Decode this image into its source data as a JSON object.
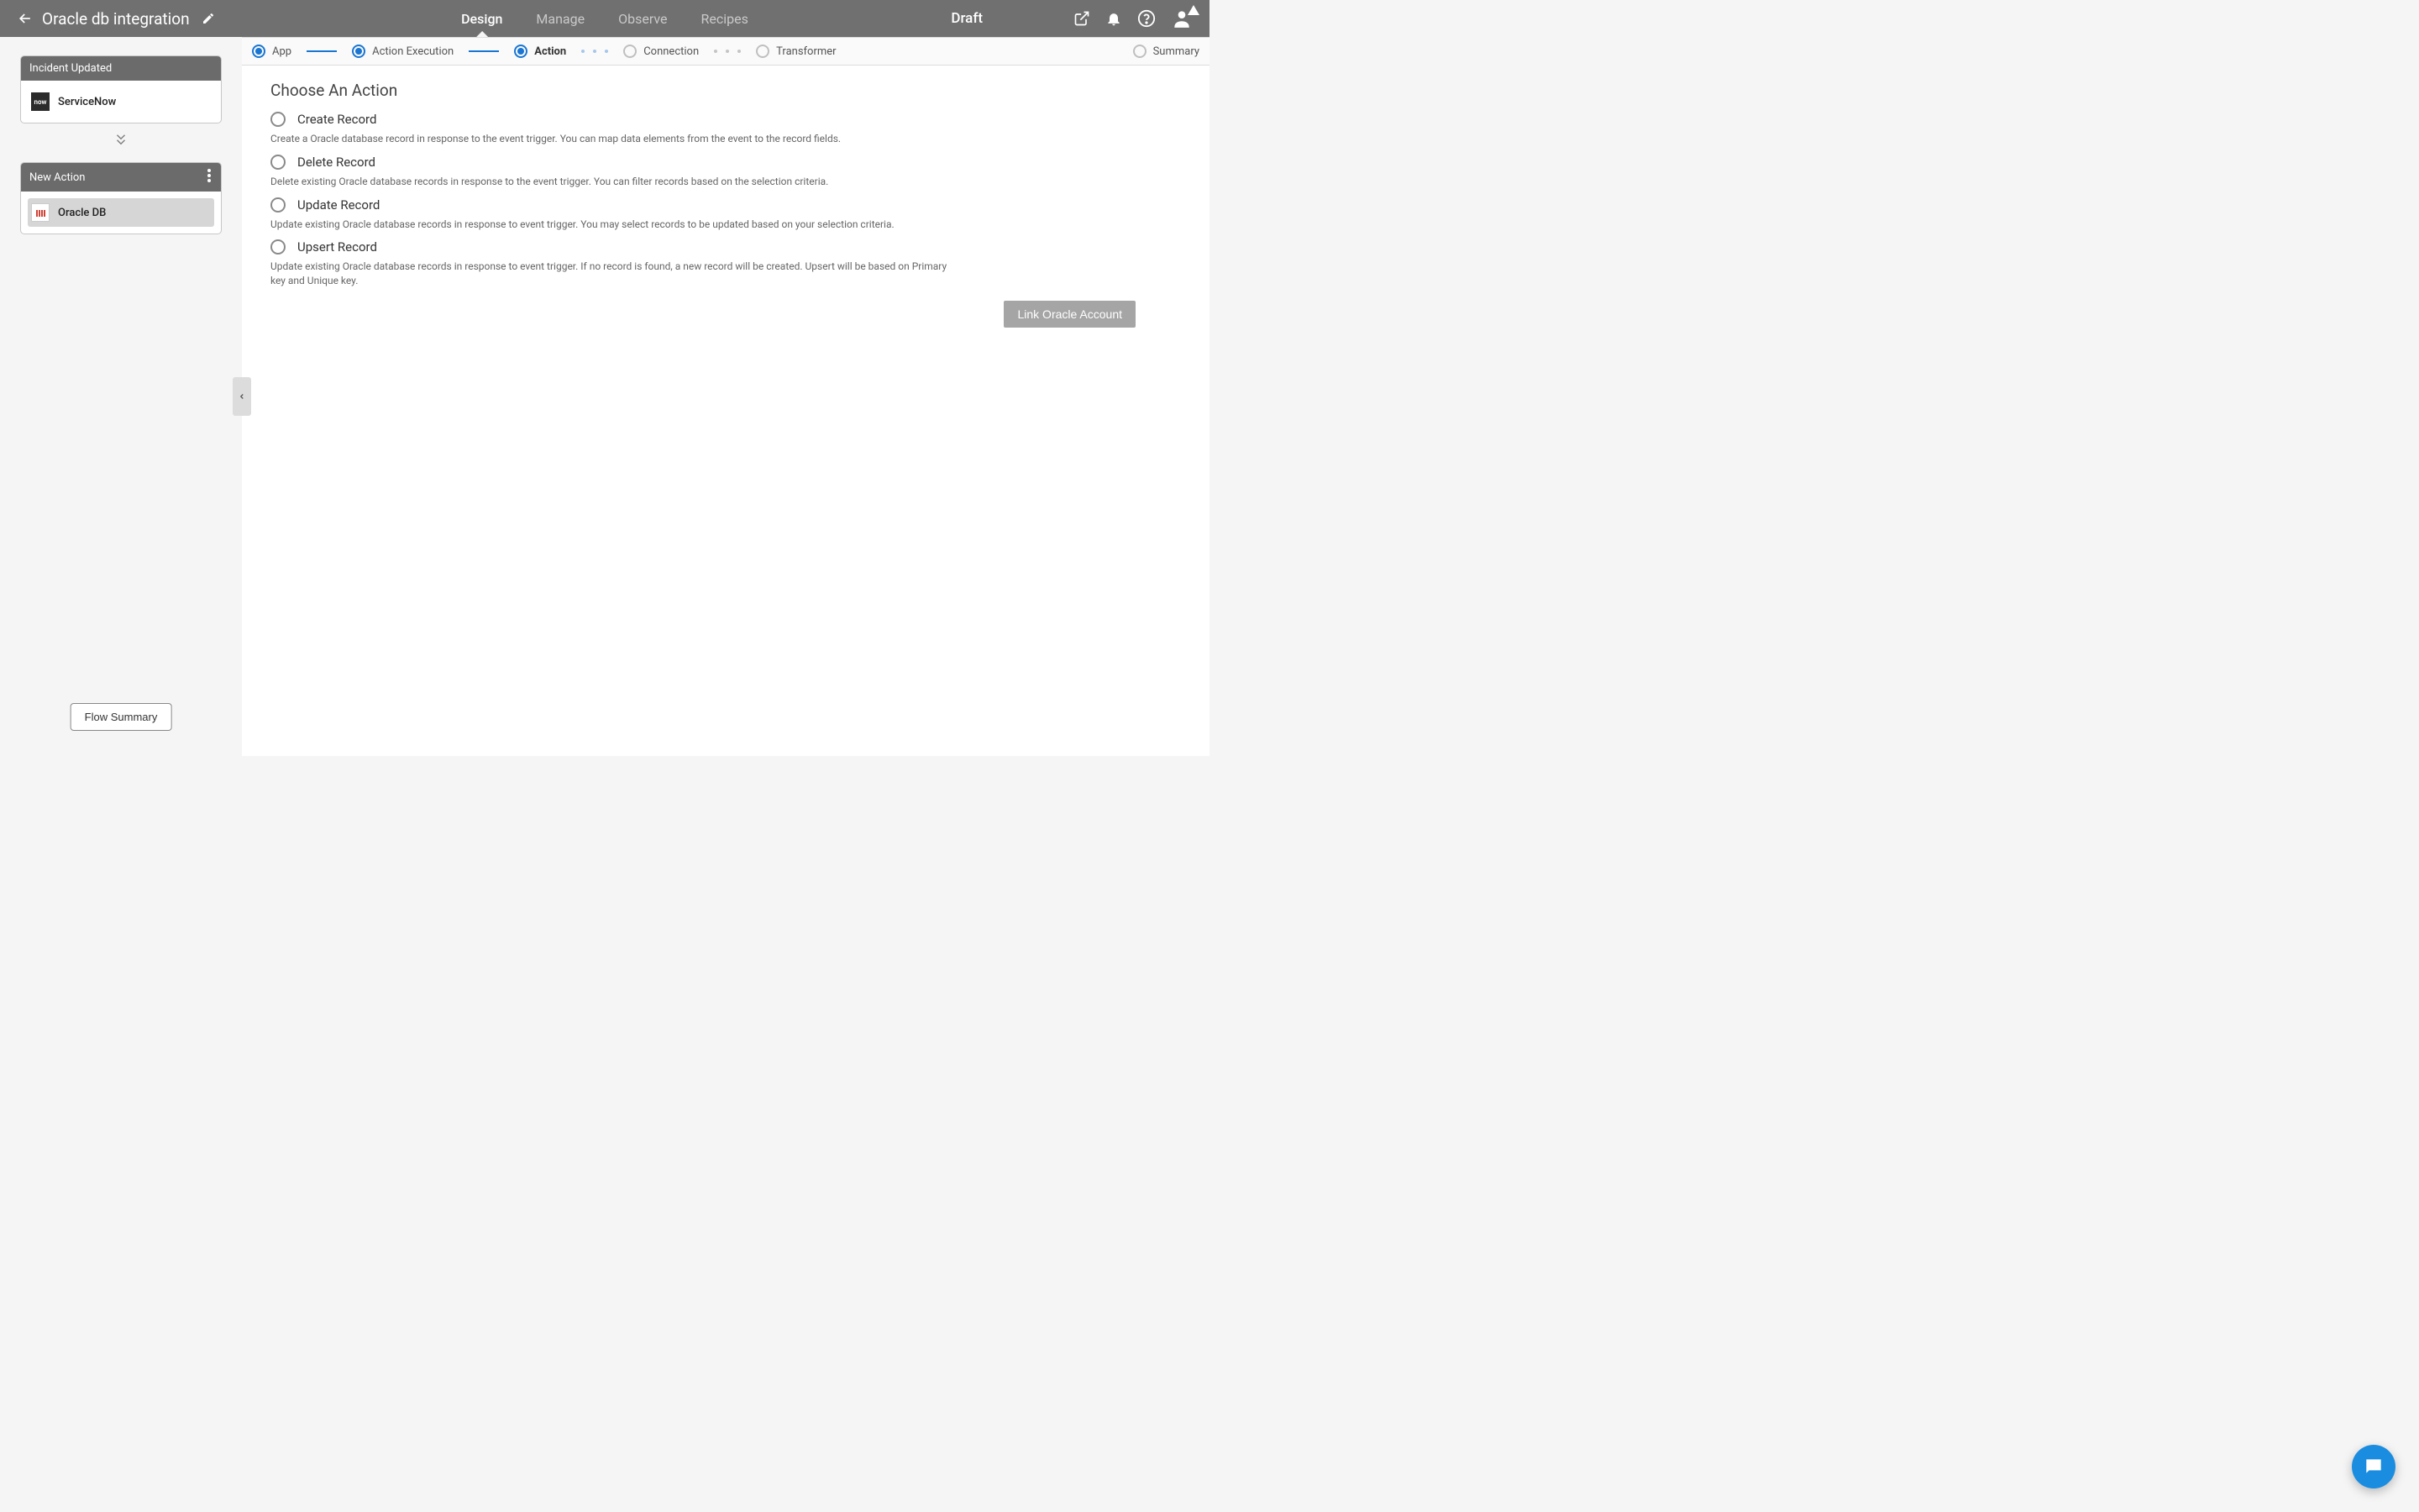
{
  "header": {
    "title": "Oracle db integration",
    "tabs": [
      "Design",
      "Manage",
      "Observe",
      "Recipes"
    ],
    "activeTab": 0,
    "status": "Draft"
  },
  "stepper": {
    "steps": [
      {
        "label": "App",
        "state": "done"
      },
      {
        "label": "Action Execution",
        "state": "done"
      },
      {
        "label": "Action",
        "state": "current"
      },
      {
        "label": "Connection",
        "state": "future"
      },
      {
        "label": "Transformer",
        "state": "future"
      },
      {
        "label": "Summary",
        "state": "future"
      }
    ]
  },
  "sidebar": {
    "trigger_card_title": "Incident Updated",
    "trigger_app": "ServiceNow",
    "action_card_title": "New Action",
    "action_app": "Oracle DB",
    "flow_summary_label": "Flow Summary"
  },
  "main": {
    "section_title": "Choose An Action",
    "actions": [
      {
        "title": "Create Record",
        "desc": "Create a Oracle database record in response to the event trigger. You can map data elements from the event to the record fields."
      },
      {
        "title": "Delete Record",
        "desc": "Delete existing Oracle database records in response to the event trigger. You can filter records based on the selection criteria."
      },
      {
        "title": "Update Record",
        "desc": "Update existing Oracle database records in response to event trigger. You may select records to be updated based on your selection criteria."
      },
      {
        "title": "Upsert Record",
        "desc": "Update existing Oracle database records in response to event trigger. If no record is found, a new record will be created. Upsert will be based on Primary key and Unique key."
      }
    ],
    "link_button": "Link Oracle Account"
  }
}
